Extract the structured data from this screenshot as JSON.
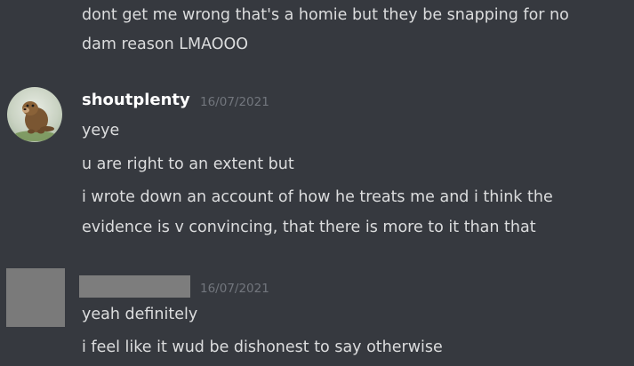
{
  "messages": {
    "prev_lines": [
      "dont get me wrong that's a homie but they be snapping for no",
      "dam reason LMAOOO"
    ],
    "group1": {
      "username": "shoutplenty",
      "timestamp": "16/07/2021",
      "lines": [
        "yeye",
        "u are right to an extent but",
        "i wrote down an account of how he treats me and i think the",
        "evidence is v convincing, that there is more to it than that"
      ]
    },
    "group2": {
      "timestamp": "16/07/2021",
      "lines": [
        "yeah definitely",
        "i feel like it wud be dishonest to say otherwise"
      ]
    }
  },
  "icons": {
    "avatar1": "otter-avatar-icon",
    "avatar2": "redacted-avatar"
  },
  "colors": {
    "background": "#36393f",
    "text": "#dcddde",
    "username": "#ffffff",
    "timestamp": "#72767d",
    "redaction": "#7d7d7d"
  }
}
